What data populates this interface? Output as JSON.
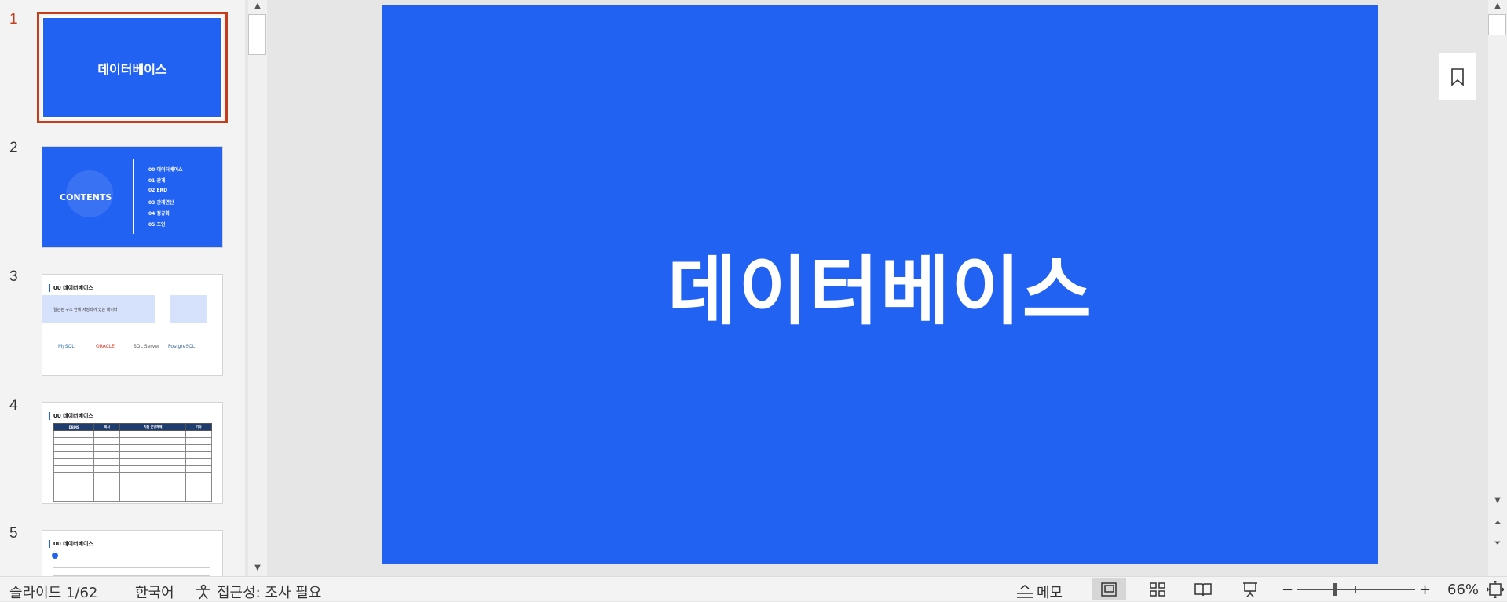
{
  "thumbnails": [
    {
      "number": "1",
      "title": "데이터베이스",
      "variant": "title"
    },
    {
      "number": "2",
      "title": "CONTENTS",
      "items": [
        "00 데이터베이스",
        "01 관계",
        "02 ERD",
        "03 관계연산",
        "04 정규화",
        "05 조인"
      ],
      "variant": "contents"
    },
    {
      "number": "3",
      "title": "00 데이터베이스",
      "box_text": "일관된 구조 안에 저장되어 있는 데이터",
      "logos": [
        "MySQL",
        "ORACLE",
        "SQL Server",
        "PostgreSQL"
      ],
      "variant": "text"
    },
    {
      "number": "4",
      "title": "00 데이터베이스",
      "table_headers": [
        "DBMS",
        "회사",
        "지원 운영체제",
        "기타"
      ],
      "variant": "table"
    },
    {
      "number": "5",
      "title": "00 데이터베이스",
      "variant": "text2"
    }
  ],
  "slide": {
    "title": "데이터베이스",
    "background": "#2262f2"
  },
  "status": {
    "slide_counter": "슬라이드 1/62",
    "language": "한국어",
    "accessibility": "접근성: 조사 필요",
    "notes_label": "메모",
    "zoom_minus": "−",
    "zoom_plus": "+",
    "zoom_level": "66%"
  },
  "colors": {
    "accent": "#c43e1c",
    "slide_blue": "#2262f2"
  }
}
